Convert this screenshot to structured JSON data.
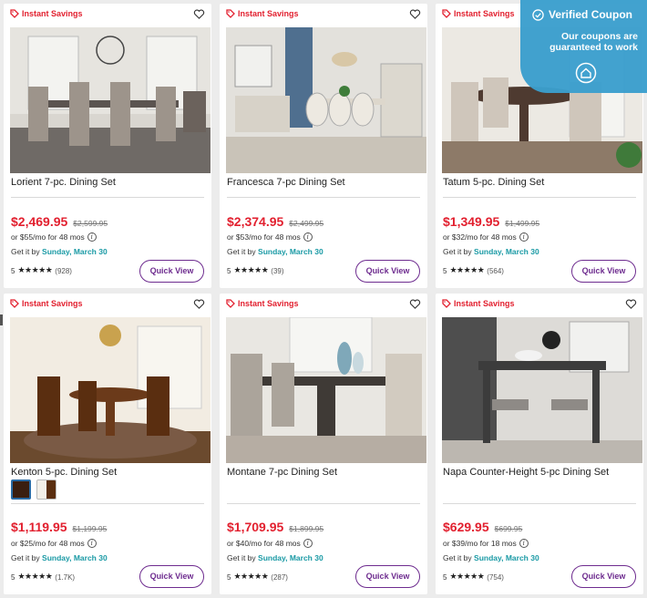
{
  "coupon": {
    "title": "Verified Coupon",
    "message": "Our coupons are guaranteed to work",
    "icon": "check-circle-icon"
  },
  "colors": {
    "price": "#e2202f",
    "delivery_date": "#1a9aa5",
    "button": "#6e2c8f",
    "coupon_bg": "#3b9fce"
  },
  "products": [
    {
      "badge": "Instant Savings",
      "name": "Lorient 7-pc. Dining Set",
      "price": "$2,469.95",
      "was": "$2,599.95",
      "finance": "or $55/mo for 48 mos",
      "delivery_prefix": "Get it by",
      "delivery_date": "Sunday, March 30",
      "rating": "5",
      "stars": "★★★★★",
      "reviews": "(928)",
      "button": "Quick View"
    },
    {
      "badge": "Instant Savings",
      "name": "Francesca 7-pc Dining Set",
      "price": "$2,374.95",
      "was": "$2,499.95",
      "finance": "or $53/mo for 48 mos",
      "delivery_prefix": "Get it by",
      "delivery_date": "Sunday, March 30",
      "rating": "5",
      "stars": "★★★★★",
      "reviews": "(39)",
      "button": "Quick View"
    },
    {
      "badge": "Instant Savings",
      "name": "Tatum 5-pc. Dining Set",
      "price": "$1,349.95",
      "was": "$1,499.95",
      "finance": "or $32/mo for 48 mos",
      "delivery_prefix": "Get it by",
      "delivery_date": "Sunday, March 30",
      "rating": "5",
      "stars": "★★★★★",
      "reviews": "(564)",
      "button": "Quick View"
    },
    {
      "badge": "Instant Savings",
      "name": "Kenton 5-pc. Dining Set",
      "price": "$1,119.95",
      "was": "$1,199.95",
      "finance": "or $25/mo for 48 mos",
      "delivery_prefix": "Get it by",
      "delivery_date": "Sunday, March 30",
      "rating": "5",
      "stars": "★★★★★",
      "reviews": "(1.7K)",
      "button": "Quick View"
    },
    {
      "badge": "Instant Savings",
      "name": "Montane 7-pc Dining Set",
      "price": "$1,709.95",
      "was": "$1,899.95",
      "finance": "or $40/mo for 48 mos",
      "delivery_prefix": "Get it by",
      "delivery_date": "Sunday, March 30",
      "rating": "5",
      "stars": "★★★★★",
      "reviews": "(287)",
      "button": "Quick View"
    },
    {
      "badge": "Instant Savings",
      "name": "Napa Counter-Height 5-pc Dining Set",
      "price": "$629.95",
      "was": "$699.95",
      "finance": "or $39/mo for 18 mos",
      "delivery_prefix": "Get it by",
      "delivery_date": "Sunday, March 30",
      "rating": "5",
      "stars": "★★★★★",
      "reviews": "(754)",
      "button": "Quick View"
    }
  ]
}
